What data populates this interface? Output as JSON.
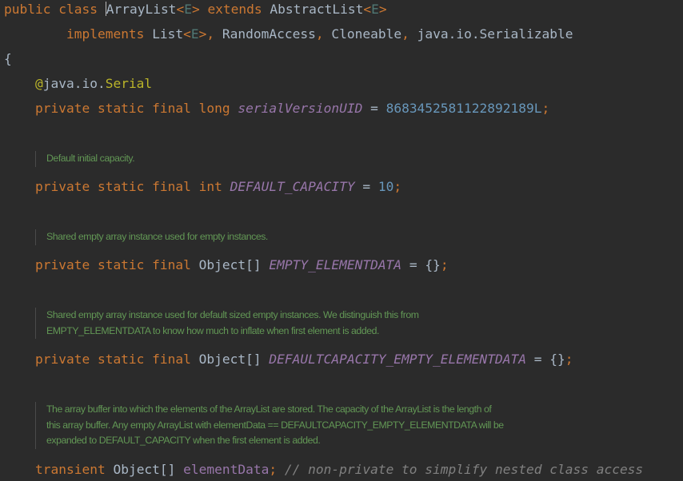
{
  "colors": {
    "background": "#2b2b2b",
    "keyword": "#cc7832",
    "default_text": "#a9b7c6",
    "type_parameter": "#507874",
    "number": "#6897bb",
    "static_field": "#9876aa",
    "annotation": "#bbb529",
    "line_comment": "#808080",
    "doc_comment": "#629755"
  },
  "code": {
    "l1": {
      "kw_public": "public",
      "kw_class": "class",
      "class_name": "ArrayList",
      "lt1": "<",
      "tp1": "E",
      "gt1": ">",
      "kw_extends": "extends",
      "super_name": "AbstractList",
      "lt2": "<",
      "tp2": "E",
      "gt2": ">"
    },
    "l2": {
      "kw_implements": "implements",
      "list": "List",
      "lt": "<",
      "tp": "E",
      "gt": ">",
      "c1": ",",
      "random_access": "RandomAccess",
      "c2": ",",
      "cloneable": "Cloneable",
      "c3": ",",
      "serializable": "java.io.Serializable"
    },
    "l3": {
      "brace": "{"
    },
    "l4": {
      "at": "@",
      "pkg": "java.io.",
      "name": "Serial"
    },
    "l5": {
      "mods": "private static final long",
      "field": "serialVersionUID",
      "eq": "=",
      "value": "8683452581122892189L",
      "semi": ";"
    },
    "l6": {
      "mods": "private static final int",
      "field": "DEFAULT_CAPACITY",
      "eq": "=",
      "value": "10",
      "semi": ";"
    },
    "l7": {
      "mods": "private static final",
      "type": "Object[]",
      "field": "EMPTY_ELEMENTDATA",
      "eq": "=",
      "value": "{}",
      "semi": ";"
    },
    "l8": {
      "mods": "private static final",
      "type": "Object[]",
      "field": "DEFAULTCAPACITY_EMPTY_ELEMENTDATA",
      "eq": "=",
      "value": "{}",
      "semi": ";"
    },
    "l9": {
      "mod": "transient",
      "type": "Object[]",
      "field": "elementData",
      "semi": ";",
      "comment": "// non-private to simplify nested class access"
    }
  },
  "docs": {
    "d1": [
      "Default initial capacity."
    ],
    "d2": [
      "Shared empty array instance used for empty instances."
    ],
    "d3": [
      "Shared empty array instance used for default sized empty instances. We distinguish this from",
      "EMPTY_ELEMENTDATA to know how much to inflate when first element is added."
    ],
    "d4": [
      "The array buffer into which the elements of the ArrayList are stored. The capacity of the ArrayList is the length of",
      "this array buffer. Any empty ArrayList with elementData == DEFAULTCAPACITY_EMPTY_ELEMENTDATA will be",
      "expanded to DEFAULT_CAPACITY when the first element is added."
    ]
  }
}
